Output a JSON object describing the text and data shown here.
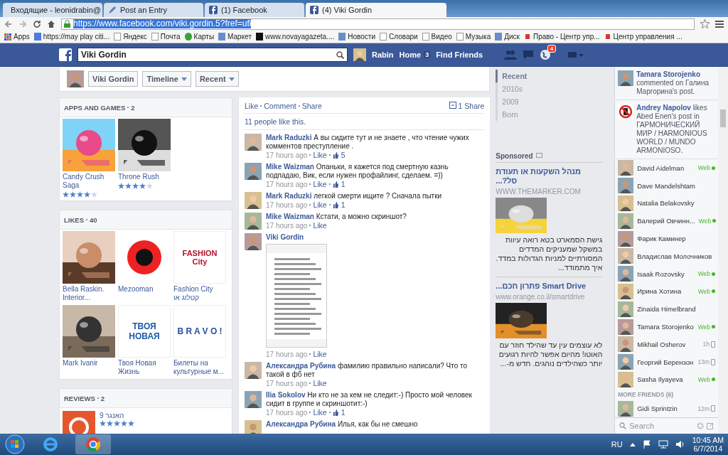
{
  "browser": {
    "tabs": [
      {
        "title": "Входящие - leonidrabin@",
        "kind": "mail",
        "selected": false
      },
      {
        "title": "Post an Entry",
        "kind": "pen",
        "selected": false
      },
      {
        "title": "(1) Facebook",
        "kind": "fb",
        "selected": false
      },
      {
        "title": "(4) Viki Gordin",
        "kind": "fb",
        "selected": true
      }
    ],
    "url": "https://www.facebook.com/viki.gordin.5?fref=ufi",
    "bookmarks": [
      {
        "label": "Apps",
        "kind": "apps"
      },
      {
        "label": "https://may play citi...",
        "kind": "g"
      },
      {
        "label": "Яндекс",
        "kind": "page"
      },
      {
        "label": "Почта",
        "kind": "page"
      },
      {
        "label": "Карты",
        "kind": "green"
      },
      {
        "label": "Маркет",
        "kind": "blue"
      },
      {
        "label": "www.novayagazeta....",
        "kind": "h"
      },
      {
        "label": "Новости",
        "kind": "blue"
      },
      {
        "label": "Словари",
        "kind": "page"
      },
      {
        "label": "Видео",
        "kind": "page"
      },
      {
        "label": "Музыка",
        "kind": "page"
      },
      {
        "label": "Диск",
        "kind": "blue"
      },
      {
        "label": "Право - Центр упр...",
        "kind": "red"
      },
      {
        "label": "Центр управления ...",
        "kind": "red"
      }
    ]
  },
  "topbar": {
    "search": "Viki Gordin",
    "user": "Rabin",
    "home": "Home",
    "home_count": "3",
    "find_friends": "Find Friends",
    "notifications": "4"
  },
  "profile_bar": {
    "name": "Viki Gordin",
    "menus": [
      "Timeline",
      "Recent"
    ]
  },
  "apps": {
    "title": "APPS AND GAMES",
    "count": "2",
    "items": [
      {
        "name": "Candy Crush Saga",
        "stars": 4
      },
      {
        "name": "Throne Rush",
        "stars": 4
      }
    ]
  },
  "likes": {
    "title": "LIKES",
    "count": "40",
    "items": [
      {
        "name": "Bella Raskin. Interior..."
      },
      {
        "name": "Mezooman",
        "kind": "target"
      },
      {
        "name": "Fashion City קטלוג או",
        "kind": "logo",
        "logo_text": "FASHION City"
      },
      {
        "name": "Mark Ivanir"
      },
      {
        "name": "Твоя Новая Жизнь",
        "kind": "logo",
        "logo_text": "ТВОЯ НОВАЯ"
      },
      {
        "name": "Билеты на культурные м...",
        "kind": "logo",
        "logo_text": "B R A V O !"
      }
    ]
  },
  "reviews": {
    "title": "REVIEWS",
    "count": "2",
    "items": [
      {
        "name": "האנגר 9",
        "stars": 5
      }
    ]
  },
  "post": {
    "actions": [
      "Like",
      "Comment",
      "Share"
    ],
    "shares": "1 Share",
    "likes_summary": "11 people like this.",
    "comments": [
      {
        "kind": "text",
        "text": "**Mark Raduzki** А вы сидите тут и не знаете , что чтение чужих комментов преступление .",
        "time": "17 hours ago",
        "like": "Like",
        "likes": "5"
      },
      {
        "kind": "text",
        "text": "**Mike Waizman** Опаньки, я кажется под смертную казнь подпадаю, Вик, если нужен профайлинг, сделаем. =))",
        "time": "17 hours ago",
        "like": "Like",
        "likes": "1"
      },
      {
        "kind": "text",
        "text": "**Mark Raduzki** легкой смерти ищите ? Сначала пытки",
        "time": "17 hours ago",
        "like": "Like",
        "likes": "1"
      },
      {
        "kind": "text",
        "text": "**Mike Waizman** Кстати, а можно скриншот?",
        "time": "17 hours ago",
        "like": "Like"
      },
      {
        "text": "**Viki Gordin**",
        "time": "17 hours ago",
        "like": "Like"
      },
      {
        "kind": "text",
        "text": "**Александра Рубина** фамилию правильно написали? Что то такой в фб нет",
        "time": "17 hours ago",
        "like": "Like"
      },
      {
        "kind": "text",
        "text": "**Ilia Sokolov** Ни кто не за кем не следит:-) Просто мой человек сидит в группе и скриншотит:-)",
        "time": "17 hours ago",
        "like": "Like",
        "likes": "1"
      },
      {
        "kind": "text",
        "text": "**Александра Рубина** Илья, как бы не смешно"
      }
    ]
  },
  "timeline_nav": [
    {
      "label": "Recent",
      "selected": true
    },
    {
      "label": "2010s",
      "selected": false
    },
    {
      "label": "2009",
      "selected": false
    },
    {
      "label": "Born",
      "selected": false
    }
  ],
  "sponsored": {
    "title": "Sponsored",
    "ads": [
      {
        "title": "מנהל השקעות או תעודת סל?...",
        "url": "WWW.THEMARKER.COM",
        "text": "גישת הסמארט בטא רואה עיוות במשקל שמעניקים המדדים המסורתיים למניות הגדולות במדד. איך מתמודד..."
      },
      {
        "title": "Smart Drive פתרון חכם...",
        "url": "www.orange.co.il/smartdrive",
        "text": "לא עוצמים עין עד שהילד חוזר עם האוטו! מהיום אפשר להיות רגועים יותר כשהילדים נוהגים. חדש מ-..."
      }
    ]
  },
  "ticker": [
    {
      "kind": "person",
      "text": "**Tamara Storojenko** commented on Галина Маргорина's post."
    },
    {
      "kind": "sign",
      "text": "**Andrey Napolov** likes Abed Enen's post in ГАРМОНИЧЕСКИЙ МИР / HARMONIOUS WORLD / MUNDO ARMONIOSO."
    }
  ],
  "chat": {
    "friends": [
      {
        "name": "David Aidelman",
        "kind": "web",
        "status": "Web"
      },
      {
        "name": "Dave Mandelshtam",
        "kind": "none"
      },
      {
        "name": "Natalia Belakovsky",
        "kind": "none"
      },
      {
        "name": "Валерий Овчинн...",
        "kind": "web",
        "status": "Web"
      },
      {
        "name": "Фарик Каминер",
        "kind": "none"
      },
      {
        "name": "Владислав Молочников",
        "kind": "none"
      },
      {
        "name": "Isaak Rozovsky",
        "kind": "web",
        "status": "Web"
      },
      {
        "name": "Ирина Хотина",
        "kind": "web",
        "status": "Web"
      },
      {
        "name": "Zinaida Himelbrand",
        "kind": "none"
      },
      {
        "name": "Tamara Storojenko",
        "kind": "web",
        "status": "Web"
      },
      {
        "name": "Mikhail Osherov",
        "kind": "mobile",
        "status": "1h"
      },
      {
        "name": "Георгий Берензон",
        "kind": "mobile",
        "status": "13m"
      },
      {
        "name": "Sasha Ilyayeva",
        "kind": "web",
        "status": "Web"
      }
    ],
    "more_title": "MORE FRIENDS (6)",
    "more": [
      {
        "name": "Gidi Sprintzin",
        "kind": "mobile",
        "status": "12m"
      }
    ],
    "search_placeholder": "Search"
  },
  "taskbar": {
    "language": "RU",
    "time": "10:45 AM",
    "date": "6/7/2014"
  }
}
